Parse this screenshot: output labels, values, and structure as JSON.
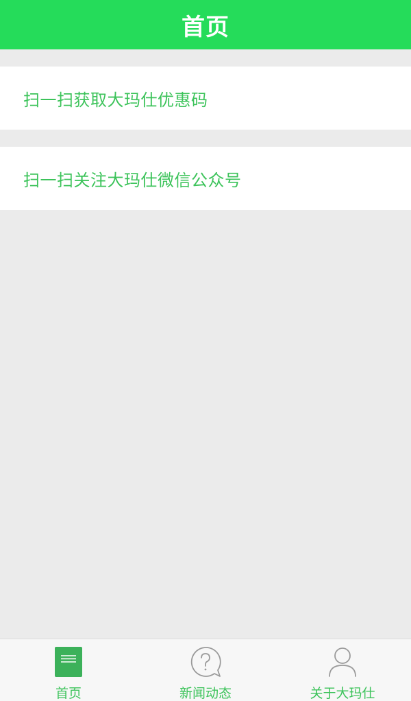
{
  "header": {
    "title": "首页"
  },
  "menu": {
    "items": [
      {
        "label": "扫一扫获取大玛仕优惠码"
      },
      {
        "label": "扫一扫关注大玛仕微信公众号"
      }
    ]
  },
  "tabbar": {
    "tabs": [
      {
        "label": "首页",
        "icon": "document-list-icon",
        "active": true
      },
      {
        "label": "新闻动态",
        "icon": "question-bubble-icon",
        "active": false
      },
      {
        "label": "关于大玛仕",
        "icon": "person-icon",
        "active": false
      }
    ]
  },
  "colors": {
    "header_bg": "#25dc5a",
    "accent_text": "#3cc35a",
    "page_bg": "#ebebeb",
    "tab_icon_active": "#3cb15a",
    "tab_icon_inactive": "#9a9a9a"
  }
}
